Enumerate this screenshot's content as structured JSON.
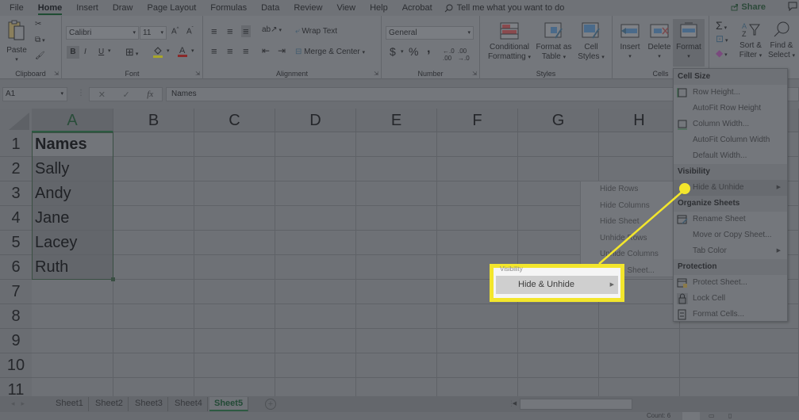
{
  "menubar": {
    "tabs": [
      "File",
      "Home",
      "Insert",
      "Draw",
      "Page Layout",
      "Formulas",
      "Data",
      "Review",
      "View",
      "Help",
      "Acrobat"
    ],
    "active_tab": "Home",
    "tell_me": "Tell me what you want to do",
    "share": "Share"
  },
  "ribbon": {
    "clipboard": {
      "paste": "Paste",
      "label": "Clipboard"
    },
    "font": {
      "name": "Calibri",
      "size": "11",
      "bold": "B",
      "italic": "I",
      "underline": "U",
      "label": "Font"
    },
    "alignment": {
      "wrap": "Wrap Text",
      "merge": "Merge & Center",
      "label": "Alignment"
    },
    "number": {
      "format": "General",
      "currency": "$",
      "percent": "%",
      "comma": ",",
      "label": "Number"
    },
    "styles": {
      "conditional": [
        "Conditional",
        "Formatting"
      ],
      "format_table": [
        "Format as",
        "Table"
      ],
      "cell_styles": [
        "Cell",
        "Styles"
      ],
      "label": "Styles"
    },
    "cells": {
      "insert": "Insert",
      "delete": "Delete",
      "format": "Format",
      "label": "Cells"
    },
    "editing": {
      "sort": [
        "Sort &",
        "Filter"
      ],
      "find": [
        "Find &",
        "Select"
      ]
    }
  },
  "formula_bar": {
    "name_box": "A1",
    "fx": "fx",
    "content": "Names"
  },
  "grid": {
    "columns": [
      "A",
      "B",
      "C",
      "D",
      "E",
      "F",
      "G",
      "H"
    ],
    "rows": [
      "1",
      "2",
      "3",
      "4",
      "5",
      "6",
      "7",
      "8",
      "9",
      "10",
      "11"
    ],
    "column_a": [
      "Names",
      "Sally",
      "Andy",
      "Jane",
      "Lacey",
      "Ruth"
    ]
  },
  "sheets": {
    "tabs": [
      "Sheet1",
      "Sheet2",
      "Sheet3",
      "Sheet4",
      "Sheet5"
    ],
    "active": "Sheet5"
  },
  "status": {
    "count": "Count: 6"
  },
  "format_menu": {
    "cell_size": "Cell Size",
    "row_height": "Row Height...",
    "autofit_row": "AutoFit Row Height",
    "column_width": "Column Width...",
    "autofit_col": "AutoFit Column Width",
    "default_width": "Default Width...",
    "visibility": "Visibility",
    "hide_unhide": "Hide & Unhide",
    "organize": "Organize Sheets",
    "rename": "Rename Sheet",
    "move_copy": "Move or Copy Sheet...",
    "tab_color": "Tab Color",
    "protection": "Protection",
    "protect_sheet": "Protect Sheet...",
    "lock_cell": "Lock Cell",
    "format_cells": "Format Cells..."
  },
  "submenu": [
    "Hide Rows",
    "Hide Columns",
    "Hide Sheet",
    "Unhide Rows",
    "Unhide Columns",
    "Unhide Sheet..."
  ],
  "callout": {
    "label": "Hide & Unhide",
    "color": "#f3e62c"
  }
}
